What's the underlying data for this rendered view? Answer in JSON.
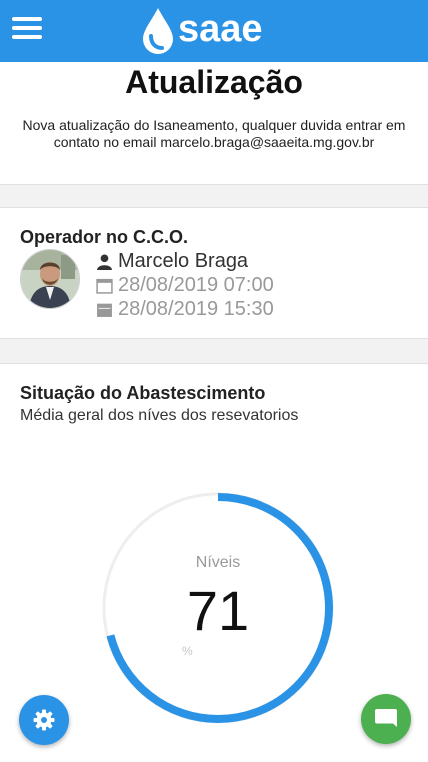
{
  "header": {
    "logo_text": "saae",
    "menu_icon": "hamburger-menu-icon",
    "background_color": "#2b93e6"
  },
  "banner": {
    "title": "Atualização",
    "text": "Nova atualização do Isaneamento, qualquer duvida entrar em contato no email marcelo.braga@saaeita.mg.gov.br",
    "slide_count": 3,
    "active_slide": 3
  },
  "operator": {
    "title": "Operador no C.C.O.",
    "name": "Marcelo Braga",
    "shift_start": "28/08/2019 07:00",
    "shift_end": "28/08/2019 15:30",
    "icons": [
      "user-icon",
      "calendar-empty-icon",
      "calendar-icon"
    ]
  },
  "supply": {
    "title": "Situação do Abastescimento",
    "subtitle": "Média geral dos níves dos resevatorios",
    "gauge_label": "Níveis",
    "gauge_value": "71",
    "gauge_unit": "%",
    "gauge_fraction": 0.71,
    "gauge_color": "#2b93e6"
  },
  "fabs": {
    "settings_icon": "gear-icon",
    "settings_color": "#2b93e6",
    "chat_icon": "chat-bubble-icon",
    "chat_color": "#4caf50"
  }
}
